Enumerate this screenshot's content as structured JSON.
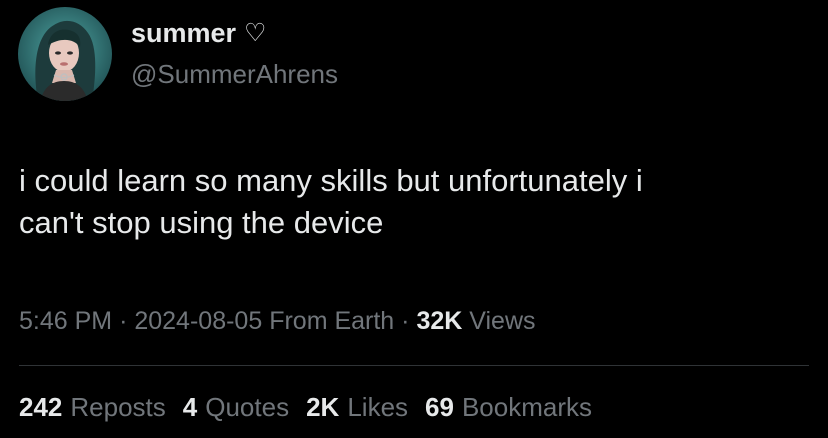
{
  "user": {
    "display_name": "summer",
    "name_emoji": "♡",
    "handle": "@SummerAhrens"
  },
  "tweet": {
    "text": "i could learn so many skills but unfortunately i\ncan't stop using the device"
  },
  "meta": {
    "time": "5:46 PM",
    "separator": "·",
    "date": "2024-08-05",
    "location": "From Earth",
    "views_count": "32K",
    "views_label": "Views"
  },
  "stats": {
    "reposts_count": "242",
    "reposts_label": "Reposts",
    "quotes_count": "4",
    "quotes_label": "Quotes",
    "likes_count": "2K",
    "likes_label": "Likes",
    "bookmarks_count": "69",
    "bookmarks_label": "Bookmarks"
  },
  "colors": {
    "background": "#000000",
    "primary_text": "#e7e9ea",
    "secondary_text": "#71767b",
    "divider": "#2f3336",
    "avatar_bg": "#2f6f70"
  }
}
